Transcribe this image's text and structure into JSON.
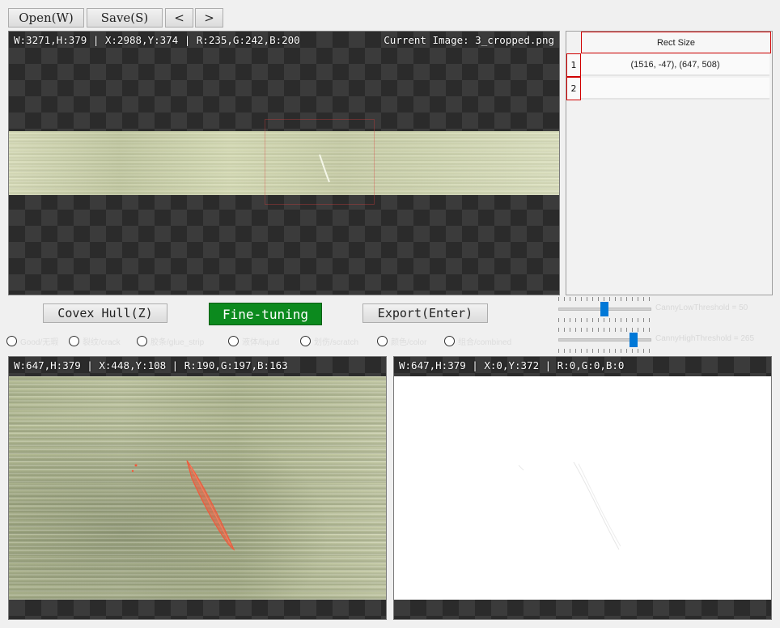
{
  "toolbar": {
    "open_label": "Open(W)",
    "save_label": "Save(S)",
    "prev_label": "<",
    "next_label": ">"
  },
  "main_view": {
    "info": "W:3271,H:379 | X:2988,Y:374 | R:235,G:242,B:200",
    "current_image": "Current Image: 3_cropped.png"
  },
  "rect_table": {
    "header": "Rect Size",
    "rows": [
      {
        "index": "1",
        "value": "(1516, -47), (647, 508)"
      },
      {
        "index": "2",
        "value": ""
      }
    ]
  },
  "actions": {
    "convex_hull": "Covex Hull(Z)",
    "fine_tuning": "Fine-tuning",
    "export": "Export(Enter)"
  },
  "sliders": {
    "low": {
      "label": "CannyLowThreshold = 50",
      "position": 0.5
    },
    "high": {
      "label": "CannyHighThreshold = 265",
      "position": 0.82
    }
  },
  "radios": [
    {
      "label": "Good/无瑕",
      "selected": false
    },
    {
      "label": "裂纹/crack",
      "selected": false
    },
    {
      "label": "胶条/glue_strip",
      "selected": false
    },
    {
      "label": "液体/liquid",
      "selected": false
    },
    {
      "label": "划伤/scratch",
      "selected": false
    },
    {
      "label": "颜色/color",
      "selected": false
    },
    {
      "label": "组合/combined",
      "selected": false
    }
  ],
  "left_view": {
    "info": "W:647,H:379 | X:448,Y:108 | R:190,G:197,B:163"
  },
  "right_view": {
    "info": "W:647,H:379 | X:0,Y:372 | R:0,G:0,B:0"
  },
  "colors": {
    "accent_green": "#0c8a1e",
    "selection_red": "#d00000",
    "slider_blue": "#0078d7"
  }
}
